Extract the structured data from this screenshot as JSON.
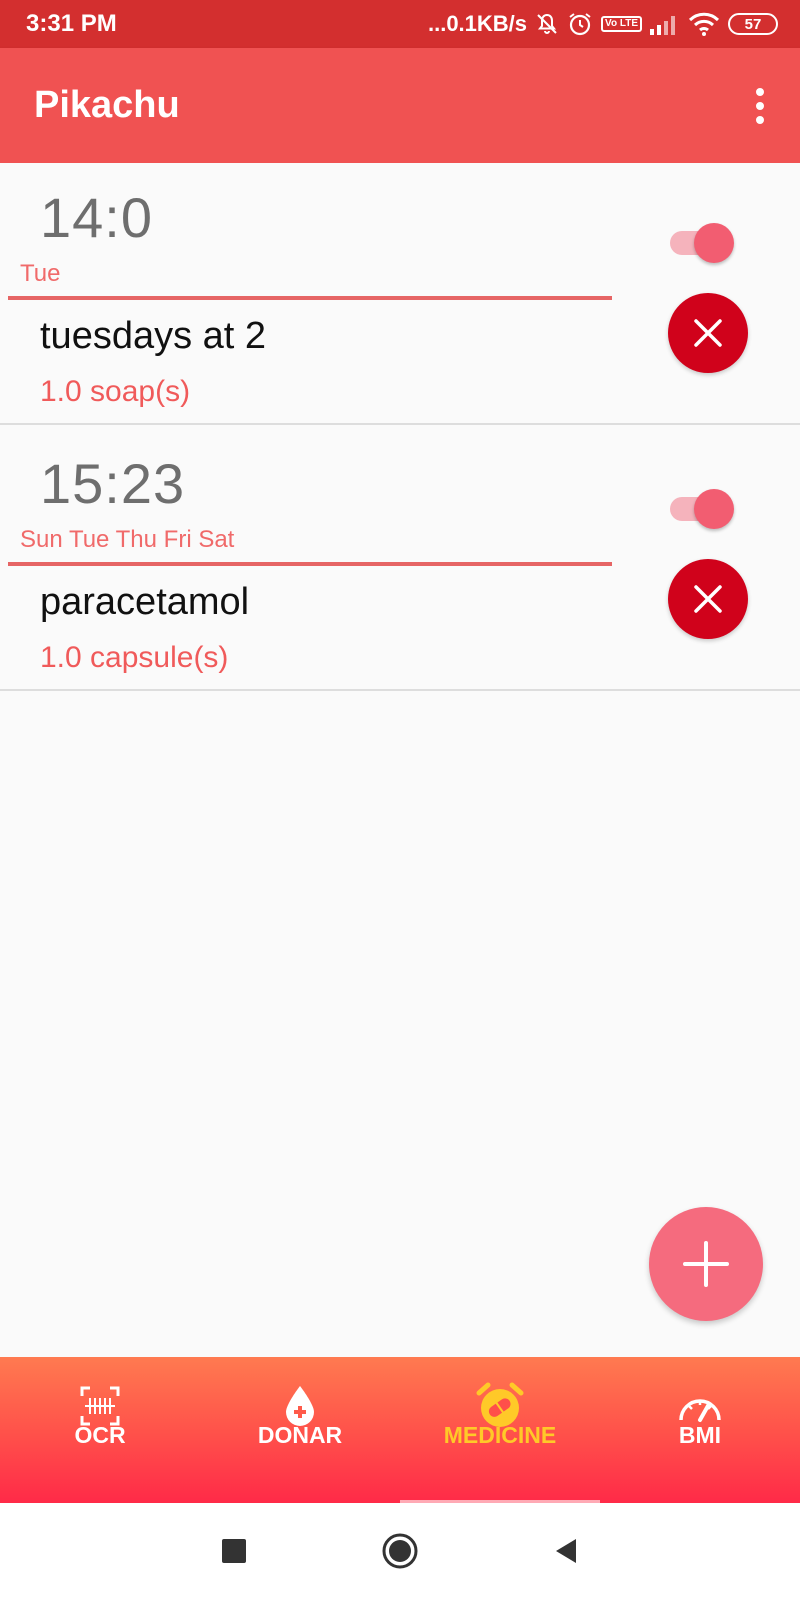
{
  "status_bar": {
    "time": "3:31 PM",
    "net_speed": "...0.1KB/s",
    "lte_label": "Vo LTE",
    "battery": "57",
    "icons": [
      "mute-icon",
      "alarm-icon",
      "lte-icon",
      "signal-icon",
      "wifi-icon",
      "battery-icon"
    ]
  },
  "app_bar": {
    "title": "Pikachu",
    "overflow_icon": "more-vert-icon"
  },
  "alarms": [
    {
      "time": "14:0",
      "days": "Tue",
      "name": "tuesdays at 2",
      "dose": "1.0 soap(s)",
      "enabled": true
    },
    {
      "time": "15:23",
      "days": "Sun Tue Thu Fri Sat",
      "name": "paracetamol",
      "dose": "1.0 capsule(s)",
      "enabled": true
    }
  ],
  "fab": {
    "icon": "plus-icon"
  },
  "bottom_nav": {
    "items": [
      {
        "label": "OCR",
        "icon": "scan-icon",
        "active": false
      },
      {
        "label": "DONAR",
        "icon": "blood-drop-icon",
        "active": false
      },
      {
        "label": "MEDICINE",
        "icon": "alarm-clock-icon",
        "active": true
      },
      {
        "label": "BMI",
        "icon": "gauge-icon",
        "active": false
      }
    ],
    "active_color": "#ffc928"
  },
  "system_nav": {
    "buttons": [
      "recents-icon",
      "home-icon",
      "back-icon"
    ]
  },
  "colors": {
    "status_bar": "#d32f2f",
    "app_bar": "#f05252",
    "accent": "#f05a5a",
    "delete": "#d0021b",
    "fab": "#f56b7e"
  }
}
